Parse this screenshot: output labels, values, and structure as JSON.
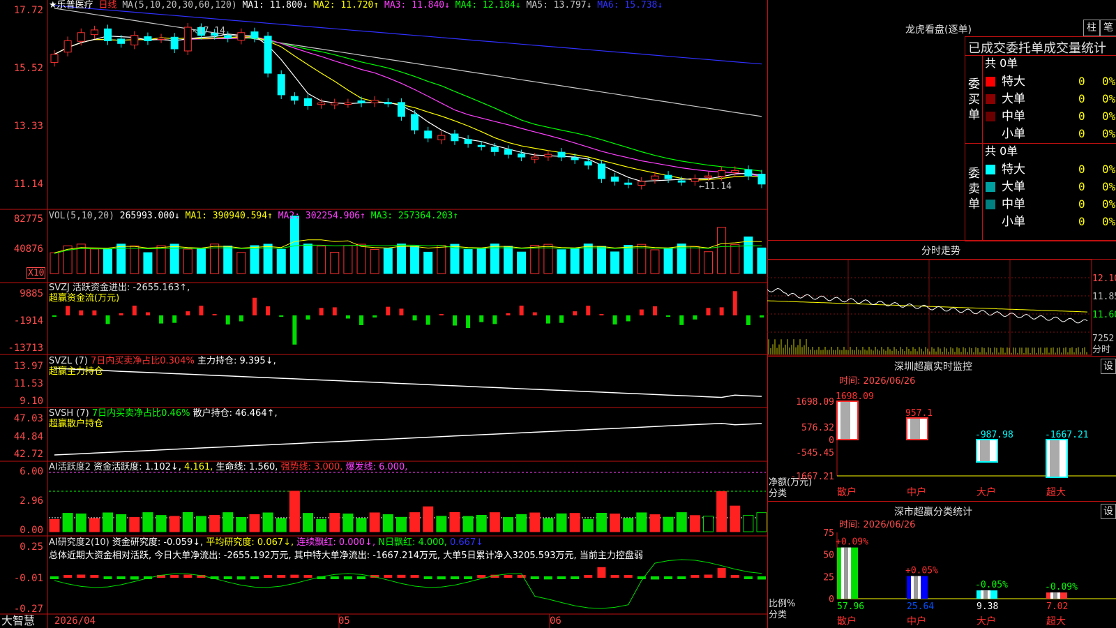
{
  "main": {
    "stock_name": "★乐普医疗",
    "period": "日线",
    "ma_label": "MA(5,10,20,30,60,120)",
    "ma": [
      {
        "label": "MA1:",
        "value": "11.800↓",
        "color": "#ffffff"
      },
      {
        "label": "MA2:",
        "value": "11.720↑",
        "color": "#ffff00"
      },
      {
        "label": "MA3:",
        "value": "11.840↓",
        "color": "#ff40ff"
      },
      {
        "label": "MA4:",
        "value": "12.184↓",
        "color": "#00ff00"
      },
      {
        "label": "MA5:",
        "value": "13.797↓",
        "color": "#c8c8c8"
      },
      {
        "label": "MA6:",
        "value": "15.738↓",
        "color": "#3030ff"
      }
    ],
    "yticks": [
      "17.72",
      "15.52",
      "13.33",
      "11.14"
    ],
    "high_mark": "17.14",
    "low_mark": "←11.14"
  },
  "vol": {
    "label": "VOL(5,10,20)",
    "value": "265993.000↓",
    "ma1": "MA1: 390940.594↑",
    "ma2": "MA2: 302254.906↑",
    "ma3": "MA3: 257364.203↑",
    "yticks": [
      "82775",
      "40876"
    ],
    "unit": "X10"
  },
  "svzj": {
    "line1": "SVZJ  活跃资金进出: -2655.163↑,",
    "line2": "超赢资金流(万元)",
    "yticks": [
      "9885",
      "-1914",
      "-13713"
    ]
  },
  "svzl": {
    "name": "SVZL (7)",
    "ratio": "7日内买卖净占比0.304%",
    "hold": "主力持仓: 9.395↓,",
    "line2": "超赢主力持仓",
    "yticks": [
      "13.97",
      "11.53",
      "9.10"
    ]
  },
  "svsh": {
    "name": "SVSH (7)",
    "ratio": "7日内买卖净占比0.46%",
    "hold": "散户持仓: 46.464↑,",
    "line2": "超赢散户持仓",
    "yticks": [
      "47.03",
      "44.84",
      "42.72"
    ]
  },
  "ai1": {
    "name": "AI活跃度2",
    "active": "资金活跃度: 1.102↓,",
    "v2": "4.161,",
    "life": "生命线: 1.560,",
    "strong": "强势线: 3.000,",
    "burst": "爆发线: 6.000,",
    "yticks": [
      "6.00",
      "2.96",
      "0.00"
    ]
  },
  "ai2": {
    "name": "AI研究度2(10)",
    "research": "资金研究度: -0.059↓,",
    "avg": "平均研究度: 0.067↓,",
    "red": "连续飘红: 0.000↓,",
    "nday": "N日飘红: 4.000,",
    "last": "0.667↓",
    "summary": "总体近期大资金相对活跃, 今日大单净流出: -2655.192万元, 其中特大单净流出: -1667.214万元, 大单5日累计净入3205.593万元, 当前主力控盘弱",
    "yticks": [
      "0.25",
      "-0.01",
      "-0.27"
    ]
  },
  "xaxis": {
    "brand": "大智慧",
    "date": "2026/04",
    "m05": "05",
    "m06": "06"
  },
  "lhb": {
    "title": "龙虎看盘(逐单)",
    "btn1": "柱",
    "btn2": "笔",
    "header": "已成交委托单成交量统计",
    "buy_label": "委买单",
    "sell_label": "委卖单",
    "buy_total": "共 0单",
    "sell_total": "共 0单",
    "rows": [
      {
        "name": "特大",
        "v": "0",
        "p": "0%"
      },
      {
        "name": "大单",
        "v": "0",
        "p": "0%"
      },
      {
        "name": "中单",
        "v": "0",
        "p": "0%"
      },
      {
        "name": "小单",
        "v": "0",
        "p": "0%"
      }
    ],
    "buy_colors": [
      "#ff0000",
      "#8b0000",
      "#6b0000",
      "#000000"
    ],
    "sell_colors": [
      "#00ffff",
      "#00a0a0",
      "#008080",
      "#000000"
    ]
  },
  "fenshi": {
    "title": "分时走势",
    "yticks": [
      "12.10",
      "11.85",
      "11.60",
      "7252"
    ],
    "unit": "分时"
  },
  "monitor": {
    "title": "深圳超赢实时监控",
    "set": "设",
    "time": "时间: 2026/06/26",
    "yticks": [
      "1698.09",
      "576.32",
      "0",
      "-545.45",
      "-1667.21"
    ],
    "ylabel": "净额(万元)",
    "xlabel": "分类",
    "cats": [
      "散户",
      "中户",
      "大户",
      "超大"
    ],
    "values": [
      1698.09,
      957.1,
      -987.98,
      -1667.21
    ],
    "value_labels": [
      "1698.09",
      "957.1",
      "-987.98",
      "-1667.21"
    ]
  },
  "classify": {
    "title": "深市超赢分类统计",
    "set": "设",
    "time": "时间: 2026/06/26",
    "yticks": [
      "75",
      "50",
      "25",
      "0"
    ],
    "ylabel": "比例%",
    "xlabel": "分类",
    "cats": [
      "散户",
      "中户",
      "大户",
      "超大"
    ],
    "values": [
      57.96,
      25.64,
      9.38,
      7.02
    ],
    "value_labels": [
      "57.96",
      "25.64",
      "9.38",
      "7.02"
    ],
    "changes": [
      "+0.09%",
      "+0.05%",
      "-0.05%",
      "-0.09%"
    ]
  },
  "chart_data": {
    "type": "bar",
    "title": "",
    "categories": [
      "散户",
      "中户",
      "大户",
      "超大"
    ],
    "series": [
      {
        "name": "净额(万元)",
        "values": [
          1698.09,
          957.1,
          -987.98,
          -1667.21
        ]
      },
      {
        "name": "比例%",
        "values": [
          57.96,
          25.64,
          9.38,
          7.02
        ]
      }
    ],
    "candles_close_approx": [
      16.1,
      16.6,
      16.9,
      17.0,
      16.6,
      16.5,
      16.8,
      16.6,
      16.7,
      16.3,
      17.1,
      16.8,
      16.8,
      16.7,
      16.9,
      16.7,
      15.4,
      14.6,
      14.4,
      14.2,
      14.3,
      14.3,
      14.3,
      14.3,
      14.4,
      14.3,
      13.8,
      13.3,
      13.0,
      13.1,
      12.9,
      12.8,
      12.7,
      12.5,
      12.4,
      12.3,
      12.3,
      12.4,
      12.3,
      12.2,
      12.0,
      11.5,
      11.4,
      11.3,
      11.4,
      11.6,
      11.5,
      11.4,
      11.5,
      11.6,
      11.8,
      11.8,
      11.6,
      11.3
    ],
    "ylim": [
      11.14,
      17.72
    ]
  }
}
